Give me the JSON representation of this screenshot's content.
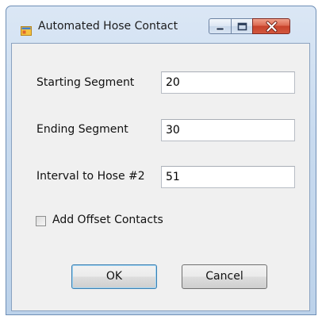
{
  "window": {
    "title": "Automated Hose Contact",
    "icon": "app-window-icon"
  },
  "caption_buttons": {
    "minimize_icon": "minimize-icon",
    "maximize_icon": "maximize-icon",
    "close_icon": "close-icon",
    "close_color": "#c7422b"
  },
  "form": {
    "starting_segment": {
      "label": "Starting Segment",
      "value": "20"
    },
    "ending_segment": {
      "label": "Ending Segment",
      "value": "30"
    },
    "interval_to_hose2": {
      "label": "Interval to Hose #2",
      "value": "51"
    },
    "add_offset_contacts": {
      "label": "Add Offset Contacts",
      "checked": false
    }
  },
  "buttons": {
    "ok_label": "OK",
    "cancel_label": "Cancel"
  }
}
